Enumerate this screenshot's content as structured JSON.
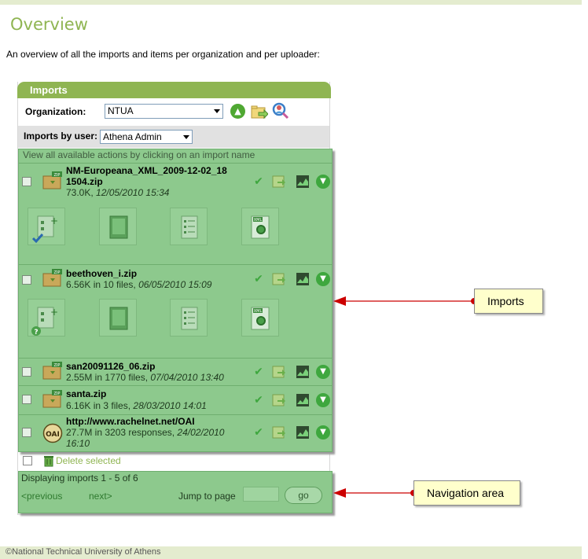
{
  "page": {
    "title": "Overview",
    "intro": "An overview of all the imports and items per organization and per uploader:",
    "footer": "©National Technical University of Athens"
  },
  "panel": {
    "header": "Imports",
    "organization_label": "Organization:",
    "organization_value": "NTUA",
    "imports_by_user_label": "Imports by user:",
    "imports_by_user_value": "Athena Admin",
    "hint": "View all available actions by clicking on an import name"
  },
  "imports": [
    {
      "name_line1": "NM-Europeana_XML_2009-12-02_18",
      "name_line2": "1504.zip",
      "info": "73.0K, ",
      "date": "12/05/2010 15:34",
      "type": "zip"
    },
    {
      "name_line1": "beethoven_i.zip",
      "name_line2": "",
      "info": "6.56K in 10 files, ",
      "date": "06/05/2010 15:09",
      "type": "zip"
    },
    {
      "name_line1": "san20091126_06.zip",
      "name_line2": "",
      "info": "2.55M in 1770 files, ",
      "date": "07/04/2010 13:40",
      "type": "zip"
    },
    {
      "name_line1": "santa.zip",
      "name_line2": "",
      "info": "6.16K in 3 files, ",
      "date": "28/03/2010 14:01",
      "type": "zip"
    },
    {
      "name_line1": "http://www.rachelnet.net/OAI",
      "name_line2": "",
      "info": "27.7M in 3203 responses, ",
      "date": "24/02/2010",
      "date2": "16:10",
      "type": "oai"
    }
  ],
  "icons": {
    "oai_label": "OAI",
    "zip_label": "ZIP",
    "xml_label": "XML"
  },
  "actions": {
    "delete_label": "Delete selected"
  },
  "navigation": {
    "status": "Displaying imports 1 - 5 of 6",
    "previous": "<previous",
    "next": "next>",
    "jump_label": "Jump to page",
    "jump_value": "",
    "go": "go"
  },
  "callouts": {
    "imports": "Imports",
    "navigation": "Navigation area"
  },
  "colors": {
    "brand_green": "#8fb552",
    "list_bg": "#8dc98d",
    "callout_bg": "#ffffcc",
    "arrow_red": "#cc0000"
  }
}
